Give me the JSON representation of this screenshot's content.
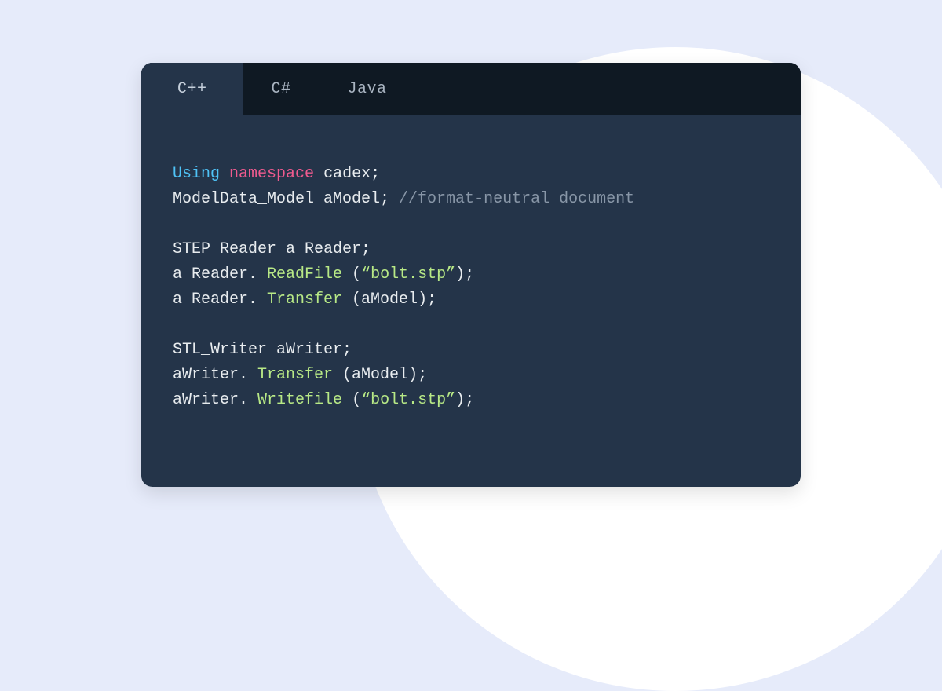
{
  "tabs": [
    {
      "label": "C++",
      "active": true
    },
    {
      "label": "C#",
      "active": false
    },
    {
      "label": "Java",
      "active": false
    }
  ],
  "code": {
    "line1": {
      "using": "Using",
      "namespace": "namespace",
      "rest": " cadex;"
    },
    "line2": {
      "text": "ModelData_Model aModel; ",
      "comment": "//format-neutral document"
    },
    "line3": "",
    "line4": "STEP_Reader a Reader;",
    "line5": {
      "prefix": "a Reader. ",
      "method": "ReadFile",
      "mid": " (",
      "string": "“bolt.stp”",
      "suffix": ");"
    },
    "line6": {
      "prefix": "a Reader. ",
      "method": "Transfer",
      "suffix": " (aModel);"
    },
    "line7": "",
    "line8": "STL_Writer aWriter;",
    "line9": {
      "prefix": "aWriter. ",
      "method": "Transfer",
      "suffix": " (aModel);"
    },
    "line10": {
      "prefix": "aWriter. ",
      "method": "Writefile",
      "mid": " (",
      "string": "“bolt.stp”",
      "suffix": ");"
    }
  }
}
